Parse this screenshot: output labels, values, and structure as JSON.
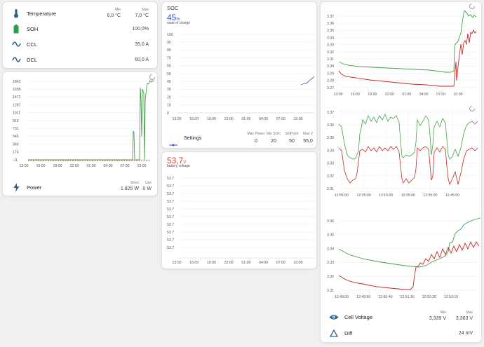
{
  "status_card": {
    "temperature": {
      "label": "Temperature",
      "min_header": "Min",
      "max_header": "Max",
      "min": "6,0 °C",
      "max": "7,0 °C"
    },
    "soh": {
      "label": "SOH",
      "value": "100,0%"
    },
    "ccl": {
      "label": "CCL",
      "value": "35,0 A"
    },
    "dcl": {
      "label": "DCL",
      "value": "60,0 A"
    }
  },
  "power_card": {
    "y_ticks": [
      "1843",
      "1658",
      "1472",
      "1287",
      "1101",
      "916",
      "731",
      "545",
      "360",
      "174",
      "-11"
    ],
    "x_ticks": [
      "13:00",
      "16:00",
      "19:00",
      "22:00",
      "01:00",
      "04:00",
      "07:00",
      "10:00"
    ],
    "label": "Power",
    "store_header": "Store",
    "use_header": "Use",
    "store": "1.825 W",
    "use": "0 W"
  },
  "soc_card": {
    "title": "SOC",
    "value": "45",
    "unit": "%",
    "subtitle": "state of charge",
    "y_ticks": [
      "100",
      "90",
      "80",
      "70",
      "60",
      "50",
      "40",
      "30",
      "20",
      "10",
      "0"
    ],
    "x_ticks": [
      "13:00",
      "16:00",
      "19:00",
      "22:00",
      "01:00",
      "04:00",
      "07:00",
      "10:00"
    ],
    "settings": {
      "label": "Settings",
      "headers": [
        "Max Power",
        "Min SOC",
        "SetPoint",
        "Max V"
      ],
      "values": [
        "0",
        "20",
        "50",
        "55,0"
      ]
    }
  },
  "voltage_card": {
    "value": "53,7",
    "unit": "V",
    "subtitle": "battery voltage",
    "y_ticks": [
      "53.7",
      "53.7",
      "53.7",
      "53.7",
      "53.7",
      "53.7",
      "53.7",
      "53.7",
      "53.7",
      "53.7"
    ],
    "x_ticks": [
      "13:00",
      "16:00",
      "19:00",
      "22:00",
      "01:00",
      "04:00",
      "07:00",
      "10:00"
    ]
  },
  "cell_card": {
    "chart1": {
      "y_ticks": [
        "3.37",
        "3.36",
        "3.35",
        "3.34",
        "3.33",
        "3.32",
        "3.31",
        "3.30",
        "3.29",
        "3.28",
        "3.27"
      ],
      "x_ticks": [
        "13:00",
        "16:00",
        "19:00",
        "22:00",
        "01:00",
        "04:00",
        "07:00",
        "10:00"
      ]
    },
    "chart2": {
      "y_ticks": [
        "3.37",
        "3.36",
        "3.35",
        "3.34",
        "3.33",
        "3.32",
        "3.31"
      ],
      "x_ticks": [
        "11:55:00",
        "12:05:00",
        "12:15:00",
        "12:25:00",
        "12:35:00",
        "12:45:00"
      ]
    },
    "chart3": {
      "y_ticks": [
        "3.36",
        "3.35",
        "3.34",
        "3.33",
        "3.32",
        "3.31"
      ],
      "x_ticks": [
        "12:49:00",
        "12:49:50",
        "12:50:40",
        "12:51:30",
        "12:52:20",
        "12:53:10"
      ]
    },
    "cell_voltage": {
      "label": "Cell Voltage",
      "min_header": "Min",
      "max_header": "Max",
      "min": "3,339 V",
      "max": "3,363 V"
    },
    "diff": {
      "label": "Diff",
      "value": "24 mV"
    }
  },
  "colors": {
    "accent": "#3f51b5",
    "green": "#43a047",
    "red": "#c62828",
    "icon_blue": "#2c5f8a",
    "voltage": "#e53935"
  }
}
